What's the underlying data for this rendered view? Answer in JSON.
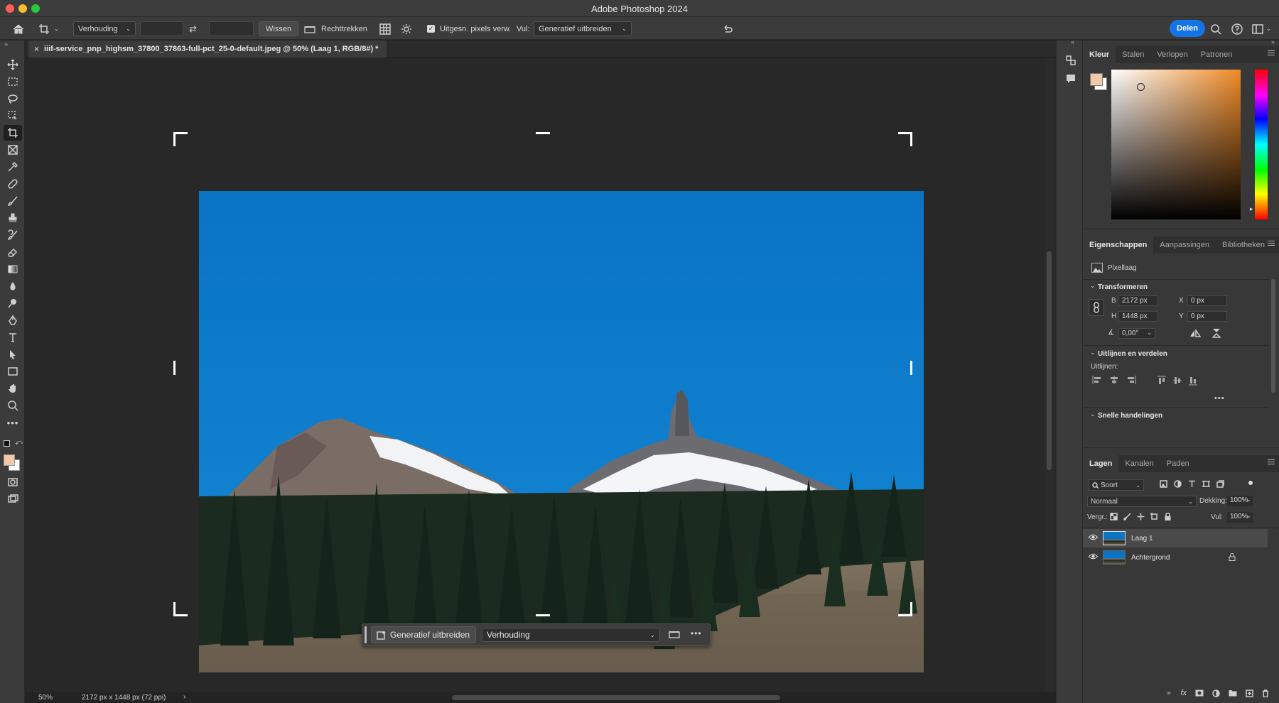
{
  "app": {
    "title": "Adobe Photoshop 2024"
  },
  "options_bar": {
    "ratio_select": "Verhouding",
    "clear_label": "Wissen",
    "straighten_label": "Rechttrekken",
    "delete_cropped_label": "Uitgesn. pixels verw.",
    "delete_cropped_checked": true,
    "fill_label": "Vul:",
    "fill_value": "Generatief uitbreiden",
    "share_label": "Delen",
    "accent": "#1473e6"
  },
  "document": {
    "tab_title": "iiif-service_pnp_highsm_37800_37863-full-pct_25-0-default.jpeg @ 50% (Laag 1, RGB/8#) *",
    "zoom": "50%",
    "doc_info": "2172 px x 1448 px (72 ppi)"
  },
  "context_bar": {
    "generative_label": "Generatief uitbreiden",
    "ratio_value": "Verhouding"
  },
  "color_panel": {
    "tabs": [
      "Kleur",
      "Stalen",
      "Verlopen",
      "Patronen"
    ],
    "foreground": "#f2c9a8",
    "background": "#ffffff"
  },
  "properties_panel": {
    "tabs": [
      "Eigenschappen",
      "Aanpassingen",
      "Bibliotheken"
    ],
    "layer_type": "Pixellaag",
    "transform_title": "Transformeren",
    "w_label": "B",
    "w_value": "2172 px",
    "h_label": "H",
    "h_value": "1448 px",
    "x_label": "X",
    "x_value": "0 px",
    "y_label": "Y",
    "y_value": "0 px",
    "angle_value": "0,00°",
    "align_title": "Uitlijnen en verdelen",
    "align_label": "Uitlijnen:",
    "quick_actions_title": "Snelle handelingen"
  },
  "layers_panel": {
    "tabs": [
      "Lagen",
      "Kanalen",
      "Paden"
    ],
    "filter_label": "Soort",
    "blend_mode": "Normaal",
    "opacity_label": "Dekking:",
    "opacity_value": "100%",
    "lock_label": "Vergr.:",
    "fill_label": "Vul:",
    "fill_value": "100%",
    "layers": [
      {
        "name": "Laag 1",
        "selected": true,
        "locked": false
      },
      {
        "name": "Achtergrond",
        "selected": false,
        "locked": true
      }
    ]
  }
}
